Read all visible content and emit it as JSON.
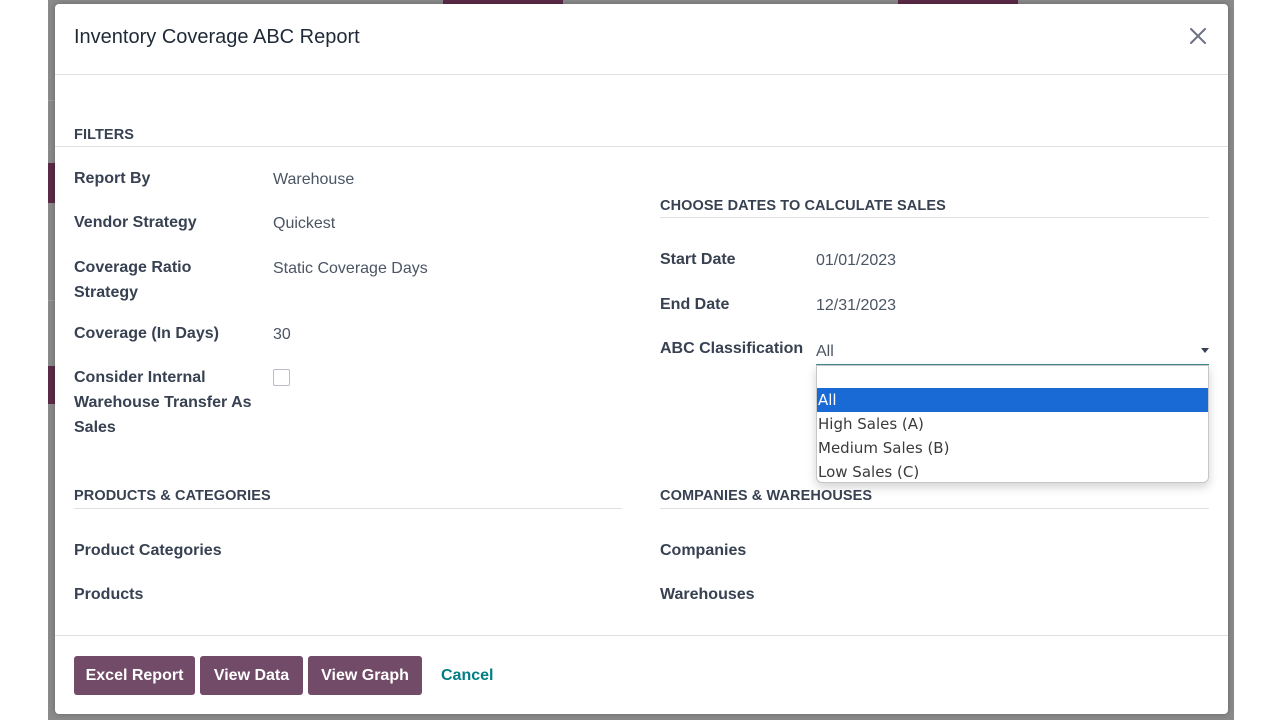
{
  "modal": {
    "title": "Inventory Coverage ABC Report"
  },
  "filters": {
    "heading": "FILTERS",
    "report_by_label": "Report By",
    "report_by_value": "Warehouse",
    "vendor_strategy_label": "Vendor Strategy",
    "vendor_strategy_value": "Quickest",
    "coverage_ratio_label_line1": "Coverage Ratio",
    "coverage_ratio_label_line2": "Strategy",
    "coverage_ratio_value": "Static Coverage Days",
    "coverage_days_label": "Coverage (In Days)",
    "coverage_days_value": "30",
    "internal_transfer_label_line1": "Consider Internal",
    "internal_transfer_label_line2": "Warehouse Transfer As",
    "internal_transfer_label_line3": "Sales",
    "internal_transfer_checked": false
  },
  "dates": {
    "heading": "CHOOSE DATES TO CALCULATE SALES",
    "start_label": "Start Date",
    "start_value": "01/01/2023",
    "end_label": "End Date",
    "end_value": "12/31/2023",
    "abc_label": "ABC Classification",
    "abc_value": "All",
    "abc_options": [
      "All",
      "High Sales (A)",
      "Medium Sales (B)",
      "Low Sales (C)"
    ],
    "abc_selected_index": 0
  },
  "products": {
    "heading": "PRODUCTS & CATEGORIES",
    "categories_label": "Product Categories",
    "products_label": "Products"
  },
  "companies": {
    "heading": "COMPANIES & WAREHOUSES",
    "companies_label": "Companies",
    "warehouses_label": "Warehouses"
  },
  "footer": {
    "excel_label": "Excel Report",
    "view_data_label": "View Data",
    "view_graph_label": "View Graph",
    "cancel_label": "Cancel"
  },
  "colors": {
    "primary_button": "#714b67",
    "link": "#017e84",
    "dropdown_selected": "#1a6ad6"
  }
}
